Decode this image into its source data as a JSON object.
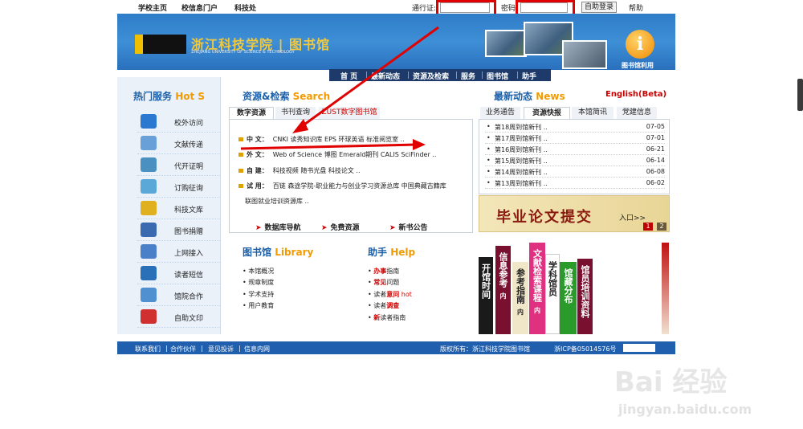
{
  "topbar": {
    "links": [
      "学校主页",
      "校信息门户",
      "科技处"
    ],
    "pass_label": "通行证:",
    "pwd_label": "密码",
    "login_btn": "自助登录",
    "help": "帮助"
  },
  "header": {
    "logo_title": "浙江科技学院 | 图书馆",
    "logo_sub": "ZHEJIANG UNIVERSITY OF SCIENCE & TECHNOLOGY",
    "info_icon": "i",
    "info_label": "图书馆利用"
  },
  "nav": [
    "首 页",
    "最新动态",
    "资源及检索",
    "服务",
    "图书馆",
    "助手"
  ],
  "sidebar": {
    "title": "热门服务",
    "title_en": "Hot S",
    "items": [
      {
        "label": "校外访问",
        "icon": "ie-icon"
      },
      {
        "label": "文献传递",
        "icon": "printer-icon"
      },
      {
        "label": "代开证明",
        "icon": "document-icon"
      },
      {
        "label": "订购征询",
        "icon": "checklist-icon"
      },
      {
        "label": "科技文库",
        "icon": "library-icon"
      },
      {
        "label": "图书捐赠",
        "icon": "book-icon"
      },
      {
        "label": "上网接入",
        "icon": "network-icon"
      },
      {
        "label": "读者短信",
        "icon": "sms-icon"
      },
      {
        "label": "馆院合作",
        "icon": "people-icon"
      },
      {
        "label": "自助文印",
        "icon": "download-icon"
      }
    ]
  },
  "resources": {
    "title": "资源&检索",
    "title_en": "Search",
    "tabs": [
      "数字资源",
      "书刊查询",
      "ZUST数字图书馆"
    ],
    "rows": [
      {
        "key": "中 文：",
        "items": "CNKI  读秀知识库  EPS  环球英语  标准阅览室  .."
      },
      {
        "key": "外 文：",
        "items": "Web of Science  博图  Emerald期刊  CALIS  SciFinder  .."
      },
      {
        "key": "自 建：",
        "items": "科技视频  随书光盘  科技论文  .."
      },
      {
        "key": "试 用：",
        "items": "百链  森途学院-职业能力与创业学习资源总库  中国典藏古籍库"
      },
      {
        "key": "",
        "items": "联图就业培训资源库  .."
      }
    ],
    "bottom_links": [
      "数据库导航",
      "免费资源",
      "新书公告"
    ]
  },
  "library": {
    "title": "图书馆",
    "title_en": "Library",
    "items": [
      "本馆概况",
      "规章制度",
      "学术支持",
      "用户教育"
    ]
  },
  "help": {
    "title": "助手",
    "title_en": "Help",
    "items": [
      {
        "red": "办事",
        "rest": "指南"
      },
      {
        "red": "常见",
        "rest": "问题"
      },
      {
        "pre": "读者",
        "red": "意问",
        "rest": " hot"
      },
      {
        "pre": "读者",
        "red": "调查",
        "rest": ""
      },
      {
        "red": "新",
        "rest": "读者指南"
      }
    ]
  },
  "news": {
    "title": "最新动态",
    "title_en": "News",
    "english_beta": "English(Beta)",
    "tabs": [
      "业务通告",
      "资源快报",
      "本馆简讯",
      "党建信息"
    ],
    "items": [
      {
        "title": "第18周到馆新刊  ..",
        "date": "07-05"
      },
      {
        "title": "第17周到馆新刊  ..",
        "date": "07-01"
      },
      {
        "title": "第16周到馆新刊  ..",
        "date": "06-21"
      },
      {
        "title": "第15周到馆新刊  ..",
        "date": "06-14"
      },
      {
        "title": "第14周到馆新刊  ..",
        "date": "06-08"
      },
      {
        "title": "第13周到馆新刊  ..",
        "date": "06-02"
      }
    ],
    "banner": "毕业论文提交",
    "banner_enter": "入口>>",
    "pages": [
      "1",
      "2"
    ]
  },
  "books": [
    {
      "text": "开馆时间",
      "color": "#1a1a1a"
    },
    {
      "text": "信息参考",
      "color": "#7a1030",
      "sub": "内"
    },
    {
      "text": "参考指南",
      "color": "#f0e6c8",
      "sub": "内"
    },
    {
      "text": "文献检索课程",
      "color": "#e03080",
      "sub": "内"
    },
    {
      "text": "学科馆员",
      "color": "#ffffff"
    },
    {
      "text": "馆藏分布",
      "color": "#2a9a2a"
    },
    {
      "text": "馆员培训资料",
      "color": "#7a1030"
    }
  ],
  "footer": {
    "links": [
      "联系我们",
      "合作伙伴",
      "意见投诉",
      "信息内网"
    ],
    "copyright": "版权所有：浙江科技学院图书馆",
    "icp": "浙ICP备05014576号"
  },
  "watermark": {
    "text": "Bai 经验",
    "url": "jingyan.baidu.com"
  },
  "colors": {
    "accent": "#1b5fa8",
    "highlight": "#f19b00",
    "annotation": "#e00000"
  }
}
